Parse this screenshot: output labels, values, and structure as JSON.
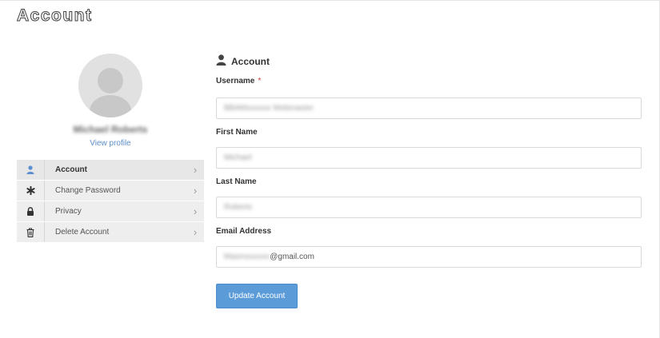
{
  "page": {
    "title": "Account"
  },
  "profile": {
    "display_name": "Michael Roberts",
    "view_profile_label": "View profile"
  },
  "menu": {
    "items": [
      {
        "label": "Account",
        "icon": "user-icon",
        "active": true
      },
      {
        "label": "Change Password",
        "icon": "asterisk-icon",
        "active": false
      },
      {
        "label": "Privacy",
        "icon": "lock-icon",
        "active": false
      },
      {
        "label": "Delete Account",
        "icon": "trash-icon",
        "active": false
      }
    ],
    "chevron": "›"
  },
  "form": {
    "section_title": "Account",
    "username": {
      "label": "Username",
      "required_mark": "*",
      "value": "BBAMxxxxxx Webmaster"
    },
    "first_name": {
      "label": "First Name",
      "value": "Michael"
    },
    "last_name": {
      "label": "Last Name",
      "value": "Roberts"
    },
    "email": {
      "label": "Email Address",
      "value_masked": "Masmxxxxxx",
      "value_domain": "@gmail.com"
    },
    "submit_label": "Update Account"
  },
  "colors": {
    "accent": "#5b9bd8",
    "link": "#5d8fc8",
    "menu_bg": "#eeeeee",
    "active_icon": "#5b8fd0"
  }
}
